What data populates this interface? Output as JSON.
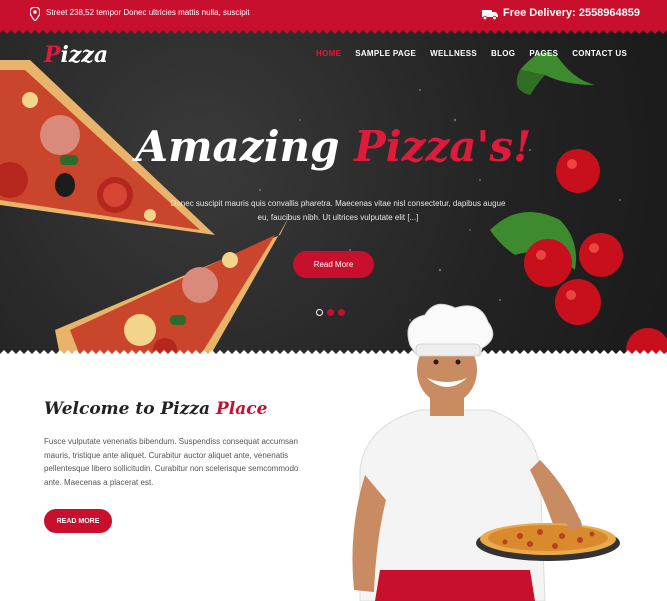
{
  "topbar": {
    "address": "Street 238,52 tempor Donec ultricies mattis nulla, suscipit",
    "delivery_label": "Free Delivery:",
    "delivery_number": "2558964859"
  },
  "logo": {
    "first_letter": "P",
    "rest": "izza"
  },
  "nav": {
    "items": [
      "HOME",
      "SAMPLE PAGE",
      "WELLNESS",
      "BLOG",
      "PAGES",
      "CONTACT US"
    ]
  },
  "hero": {
    "headline_white": "Amazing",
    "headline_red": "Pizza's!",
    "text": "Donec suscipit mauris quis convallis pharetra. Maecenas vitae nisl consectetur, dapibus augue eu, faucibus nibh. Ut ultrices vulputate elit [...]",
    "button_label": "Read More"
  },
  "welcome": {
    "title_black": "Welcome to Pizza",
    "title_red": "Place",
    "text": "Fusce vulputate venenatis bibendum. Suspendiss consequat accumsan mauris, tristique ante aliquet. Curabitur auctor aliquet ante, venenatis pellentesque libero sollicitudin. Curabitur non scelerisque semcommodo ante. Maecenas a placerat est.",
    "button_label": "READ MORE"
  },
  "colors": {
    "brand_red": "#c8102e",
    "hero_bg": "#2a2a2a"
  }
}
